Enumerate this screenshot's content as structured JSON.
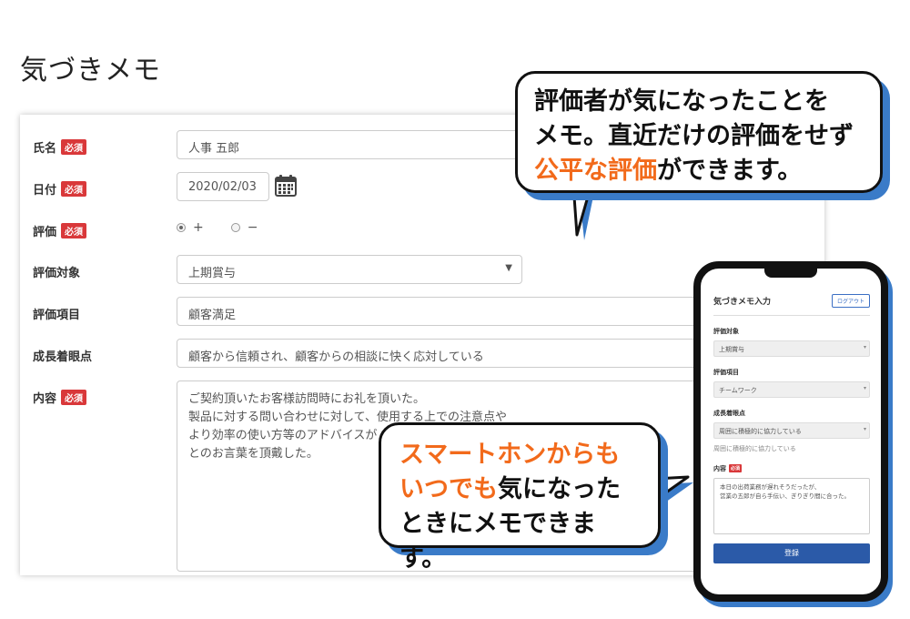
{
  "page": {
    "title": "気づきメモ"
  },
  "form": {
    "required_badge": "必須",
    "name": {
      "label": "氏名",
      "value": "人事 五郎"
    },
    "date": {
      "label": "日付",
      "value": "2020/02/03"
    },
    "rating": {
      "label": "評価",
      "options": [
        "+",
        "−"
      ],
      "selected": "+"
    },
    "target": {
      "label": "評価対象",
      "value": "上期賞与"
    },
    "item": {
      "label": "評価項目",
      "value": "顧客満足"
    },
    "growth": {
      "label": "成長着眼点",
      "value": "顧客から信頼され、顧客からの相談に快く応対している"
    },
    "content": {
      "label": "内容",
      "lines": [
        "ご契約頂いたお客様訪問時にお礼を頂いた。",
        "製品に対する問い合わせに対して、使用する上での注意点や",
        "より効率の使い方等のアドバイスが",
        "とのお言葉を頂戴した。"
      ]
    }
  },
  "bubbles": {
    "top": {
      "line1": "評価者が気になったことを",
      "line2": "メモ。直近だけの評価をせず",
      "line3_highlight": "公平な評価",
      "line3_rest": "ができます。"
    },
    "bottom": {
      "line1_highlight": "スマートホンからも",
      "line2_highlight": "いつでも",
      "line2_rest": "気になった",
      "line3": "ときにメモできます。"
    }
  },
  "phone": {
    "title": "気づきメモ入力",
    "logout": "ログアウト",
    "target_label": "評価対象",
    "target_value": "上期賞与",
    "item_label": "評価項目",
    "item_value": "チームワーク",
    "growth_label": "成長着眼点",
    "growth_value": "周囲に積極的に協力している",
    "growth_sub": "周囲に積極的に協力している",
    "content_label": "内容",
    "required_badge": "必須",
    "content_lines": [
      "本日の出荷業務が遅れそうだったが、",
      "営業の五郎が自ら手伝い、ぎりぎり間に合った。"
    ],
    "submit": "登録"
  },
  "colors": {
    "accent": "#3a7bc8",
    "highlight": "#f26a1b",
    "required": "#d9383a",
    "primary_button": "#2b5aa8"
  }
}
